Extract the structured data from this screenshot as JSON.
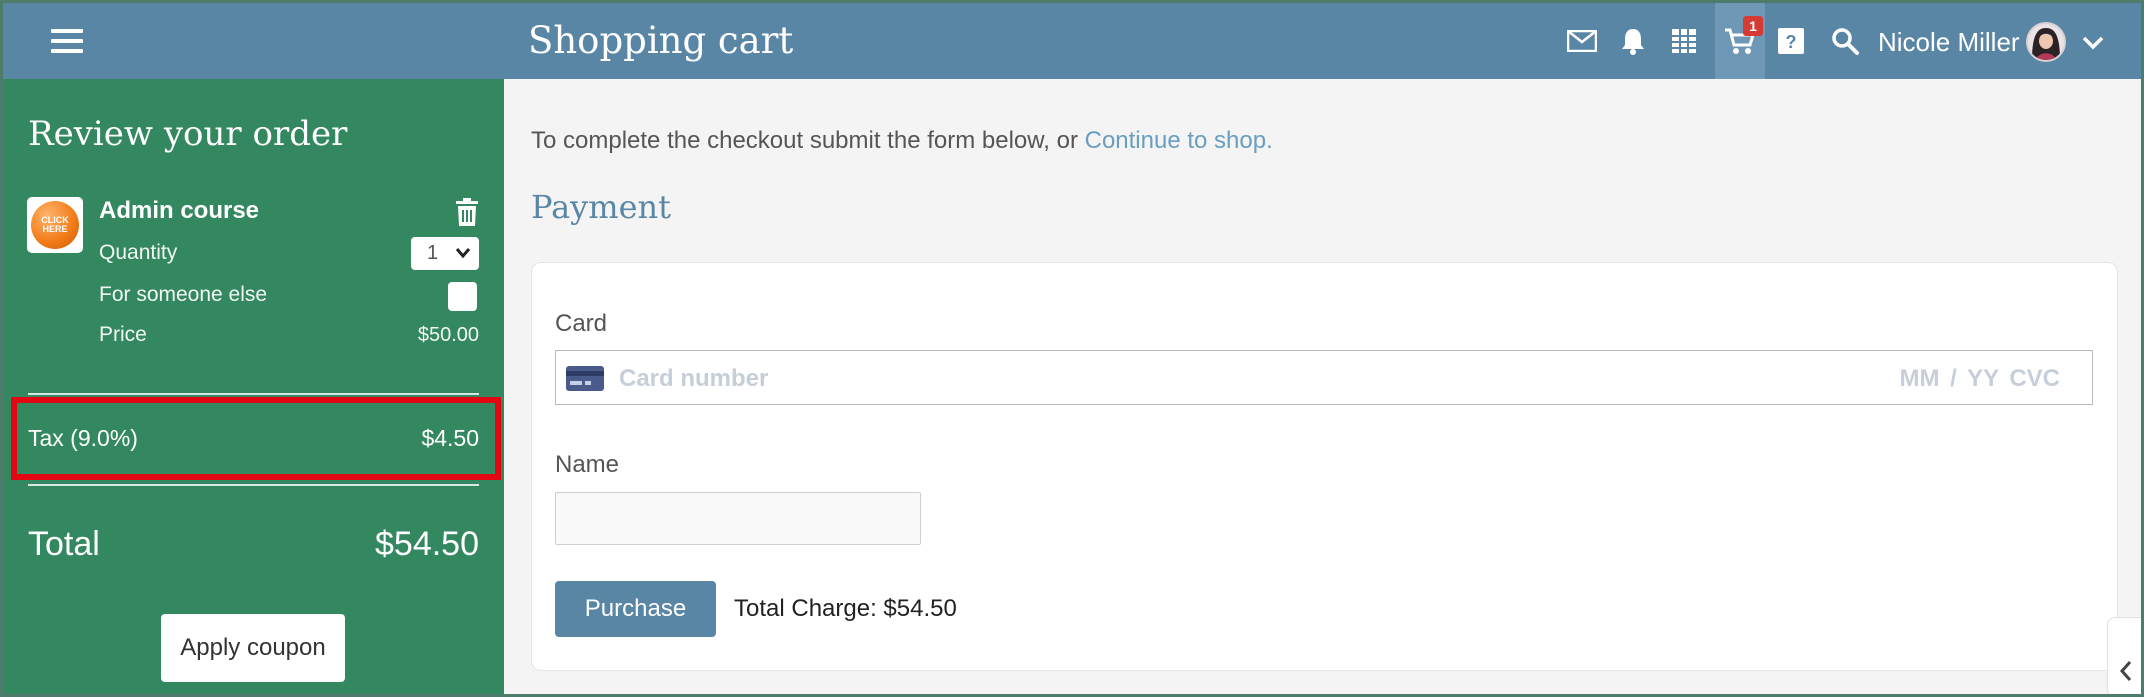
{
  "header": {
    "title": "Shopping cart",
    "cart_count": "1",
    "user_name": "Nicole Miller",
    "icons": [
      "menu-icon",
      "mail-icon",
      "bell-icon",
      "calendar-icon",
      "cart-icon",
      "help-icon",
      "search-icon",
      "chevron-down-icon"
    ]
  },
  "order": {
    "title": "Review your order",
    "product": {
      "name": "Admin course",
      "thumb_text": "CLICK HERE",
      "quantity_label": "Quantity",
      "quantity_value": "1",
      "someone_else_label": "For someone else",
      "price_label": "Price",
      "price_value": "$50.00"
    },
    "tax_label": "Tax (9.0%)",
    "tax_value": "$4.50",
    "total_label": "Total",
    "total_value": "$54.50",
    "coupon_label": "Apply coupon"
  },
  "main": {
    "intro_text": "To complete the checkout submit the form below, or ",
    "continue_link": "Continue to shop.",
    "payment_title": "Payment",
    "card_label": "Card",
    "card_placeholder": "Card number",
    "card_placeholder_right": "MM / YY  CVC",
    "name_label": "Name",
    "name_value": "",
    "purchase_label": "Purchase",
    "total_charge": "Total Charge: $54.50"
  },
  "colors": {
    "topbar": "#5a86a6",
    "sidebar": "#348860",
    "highlight": "#e30613",
    "badge": "#d63b33",
    "link": "#6a9ec0"
  }
}
